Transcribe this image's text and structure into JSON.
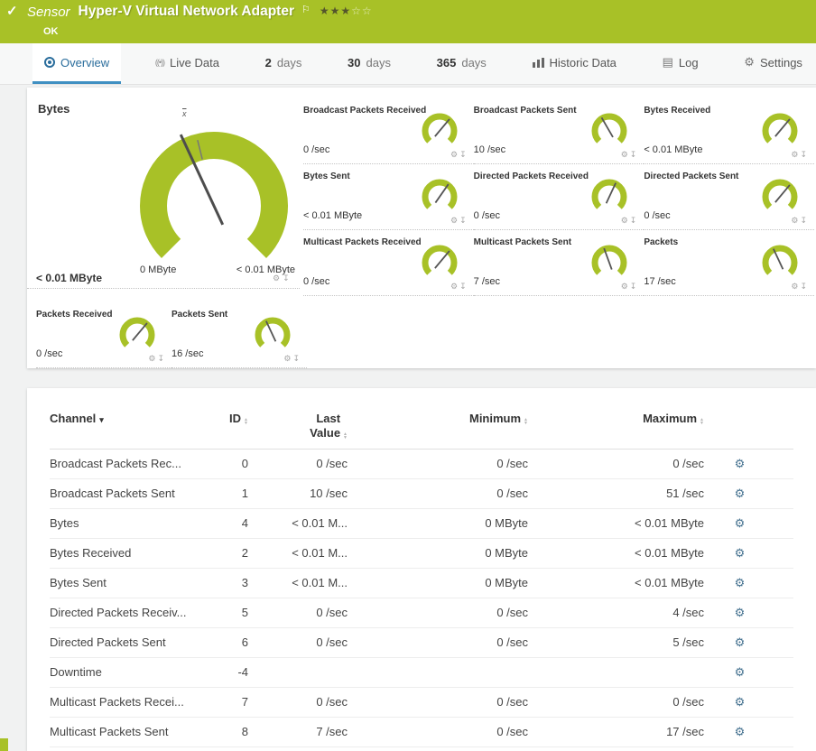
{
  "colors": {
    "brand_green": "#a8c127",
    "accent_blue": "#2a6d9c"
  },
  "header": {
    "check": "✓",
    "kind": "Sensor",
    "title": "Hyper-V Virtual Network Adapter",
    "flag": "⚐",
    "stars_filled": "★★★",
    "stars_empty": "☆☆",
    "status": "OK"
  },
  "tabs": [
    {
      "label": "Overview",
      "active": true
    },
    {
      "label": "Live Data"
    },
    {
      "strong": "2",
      "label": "days"
    },
    {
      "strong": "30",
      "label": "days"
    },
    {
      "strong": "365",
      "label": "days"
    },
    {
      "label": "Historic Data"
    },
    {
      "label": "Log"
    },
    {
      "label": "Settings"
    }
  ],
  "icons": {
    "gear": "⚙",
    "pin": "↧",
    "log": "▤",
    "live": "((•))",
    "sorted_desc": "▾",
    "sort_up": "▲",
    "sort_down": "▼"
  },
  "gauge_panel": {
    "title": "Bytes",
    "main_gauge": {
      "value": "< 0.01 MByte",
      "scale_min": "0 MByte",
      "scale_max": "< 0.01 MByte",
      "avg_label": "x",
      "needle_deg": -25
    },
    "tiles": [
      {
        "title": "Broadcast Packets Received",
        "value": "0 /sec",
        "needle_deg": 40
      },
      {
        "title": "Broadcast Packets Sent",
        "value": "10 /sec",
        "needle_deg": -30
      },
      {
        "title": "Bytes Received",
        "value": "< 0.01 MByte",
        "needle_deg": 40
      },
      {
        "title": "Bytes Sent",
        "value": "< 0.01 MByte",
        "needle_deg": 35
      },
      {
        "title": "Directed Packets Received",
        "value": "0 /sec",
        "needle_deg": 25
      },
      {
        "title": "Directed Packets Sent",
        "value": "0 /sec",
        "needle_deg": 40
      },
      {
        "title": "Multicast Packets Received",
        "value": "0 /sec",
        "needle_deg": 40
      },
      {
        "title": "Multicast Packets Sent",
        "value": "7 /sec",
        "needle_deg": -20
      },
      {
        "title": "Packets",
        "value": "17 /sec",
        "needle_deg": -25
      },
      {
        "title": "Packets Received",
        "value": "0 /sec",
        "needle_deg": 40
      },
      {
        "title": "Packets Sent",
        "value": "16 /sec",
        "needle_deg": -25
      }
    ]
  },
  "table": {
    "columns": [
      "Channel",
      "ID",
      "Last Value",
      "Minimum",
      "Maximum"
    ],
    "rows": [
      {
        "channel": "Broadcast Packets Rec...",
        "id": "0",
        "last": "0 /sec",
        "min": "0 /sec",
        "max": "0 /sec"
      },
      {
        "channel": "Broadcast Packets Sent",
        "id": "1",
        "last": "10 /sec",
        "min": "0 /sec",
        "max": "51 /sec"
      },
      {
        "channel": "Bytes",
        "id": "4",
        "last": "< 0.01 M...",
        "min": "0 MByte",
        "max": "< 0.01 MByte"
      },
      {
        "channel": "Bytes Received",
        "id": "2",
        "last": "< 0.01 M...",
        "min": "0 MByte",
        "max": "< 0.01 MByte"
      },
      {
        "channel": "Bytes Sent",
        "id": "3",
        "last": "< 0.01 M...",
        "min": "0 MByte",
        "max": "< 0.01 MByte"
      },
      {
        "channel": "Directed Packets Receiv...",
        "id": "5",
        "last": "0 /sec",
        "min": "0 /sec",
        "max": "4 /sec"
      },
      {
        "channel": "Directed Packets Sent",
        "id": "6",
        "last": "0 /sec",
        "min": "0 /sec",
        "max": "5 /sec"
      },
      {
        "channel": "Downtime",
        "id": "-4",
        "last": "",
        "min": "",
        "max": ""
      },
      {
        "channel": "Multicast Packets Recei...",
        "id": "7",
        "last": "0 /sec",
        "min": "0 /sec",
        "max": "0 /sec"
      },
      {
        "channel": "Multicast Packets Sent",
        "id": "8",
        "last": "7 /sec",
        "min": "0 /sec",
        "max": "17 /sec"
      }
    ]
  }
}
